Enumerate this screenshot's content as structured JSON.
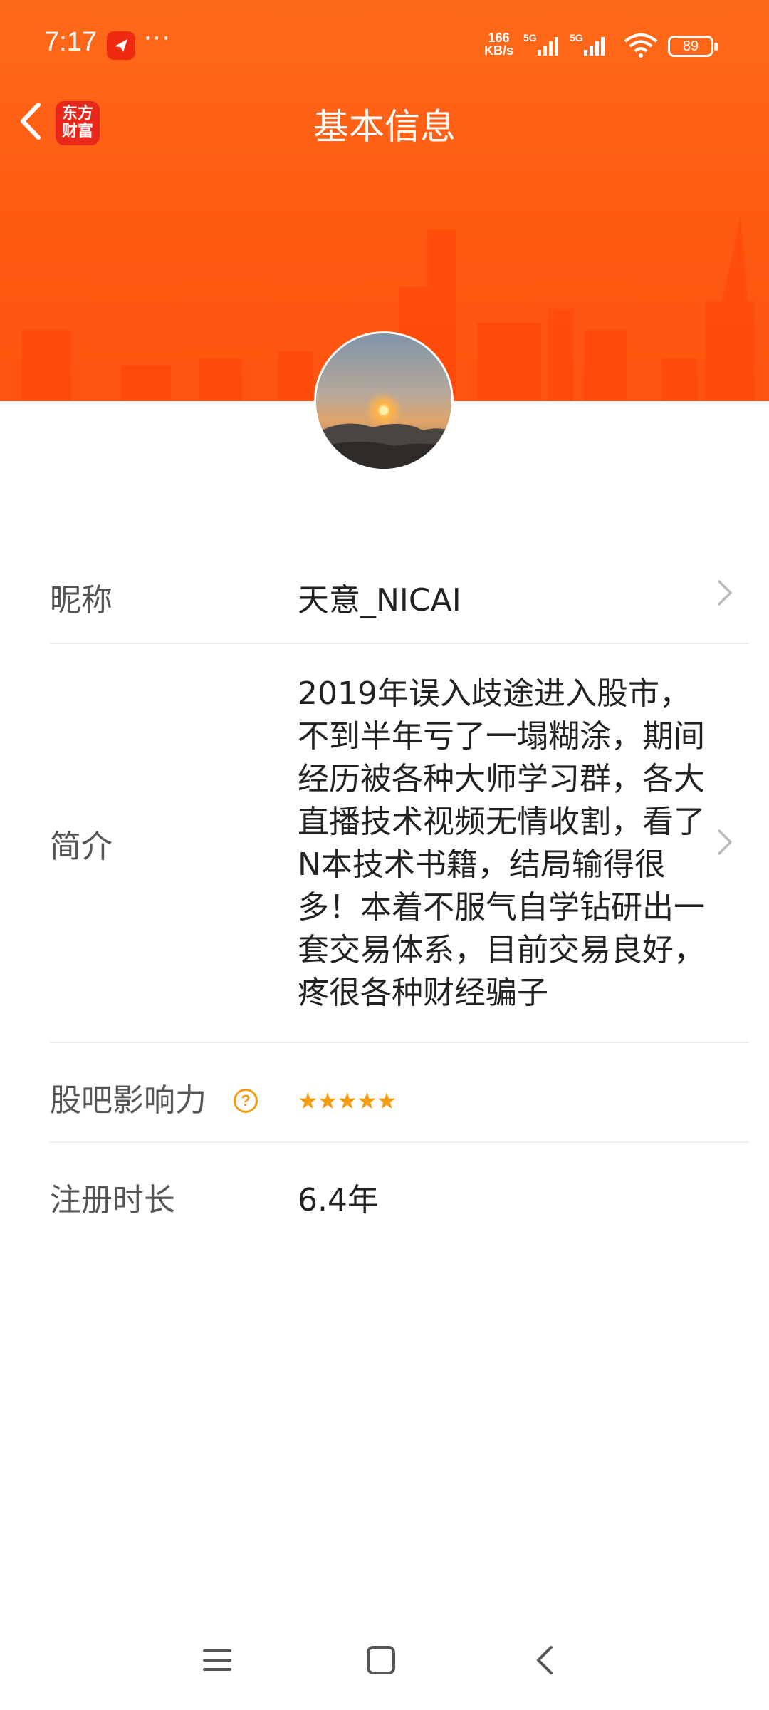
{
  "status_bar": {
    "time": "7:17",
    "more": "···",
    "net_speed_value": "166",
    "net_speed_unit": "KB/s",
    "signal1": "5G",
    "signal2": "5G",
    "battery": "89"
  },
  "nav": {
    "title": "基本信息",
    "logo_line1": "东方",
    "logo_line2": "财富"
  },
  "profile": {
    "nickname_label": "昵称",
    "nickname": "天意_NICAI",
    "bio_label": "简介",
    "bio": "2019年误入歧途进入股市，不到半年亏了一塌糊涂，期间经历被各种大师学习群，各大直播技术视频无情收割，看了N本技术书籍，结局输得很多！本着不服气自学钻研出一套交易体系，目前交易良好，疼很各种财经骗子",
    "influence_label": "股吧影响力",
    "influence_help": "?",
    "influence_stars": "★★★★★",
    "influence_rating": 5,
    "reg_label": "注册时长",
    "reg_duration": "6.4年"
  },
  "icons": {
    "back": "back-arrow-icon",
    "chevron": "chevron-right-icon",
    "menu": "menu-icon",
    "home": "home-icon",
    "sys_back": "system-back-icon"
  },
  "colors": {
    "header": "#ff5a12",
    "accent": "#f39c12",
    "logo": "#e8281b"
  }
}
